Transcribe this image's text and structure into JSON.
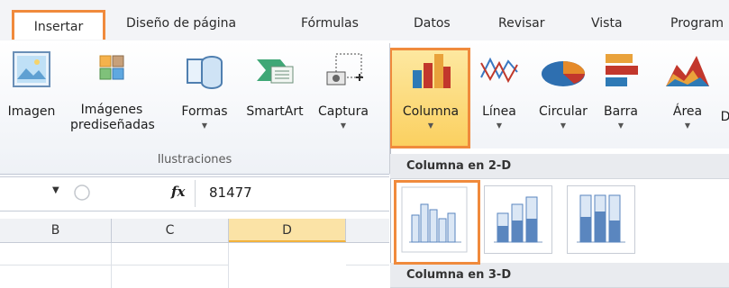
{
  "tabs": [
    "Insertar",
    "Diseño de página",
    "Fórmulas",
    "Datos",
    "Revisar",
    "Vista",
    "Program"
  ],
  "ribbon": {
    "buttons": [
      "Imagen",
      "Imágenes prediseñadas",
      "Formas",
      "SmartArt",
      "Captura",
      "Columna",
      "Línea",
      "Circular",
      "Barra",
      "Área",
      "D"
    ],
    "group_label": "Ilustraciones"
  },
  "formula_bar": {
    "fx": "fx",
    "value": "81477"
  },
  "columns": [
    "B",
    "C",
    "D"
  ],
  "dropdown": {
    "section_2d": "Columna en 2-D",
    "section_3d": "Columna en 3-D"
  },
  "colors": {
    "accent_orange": "#f08a3c",
    "highlight_yellow": "#fbd060"
  }
}
